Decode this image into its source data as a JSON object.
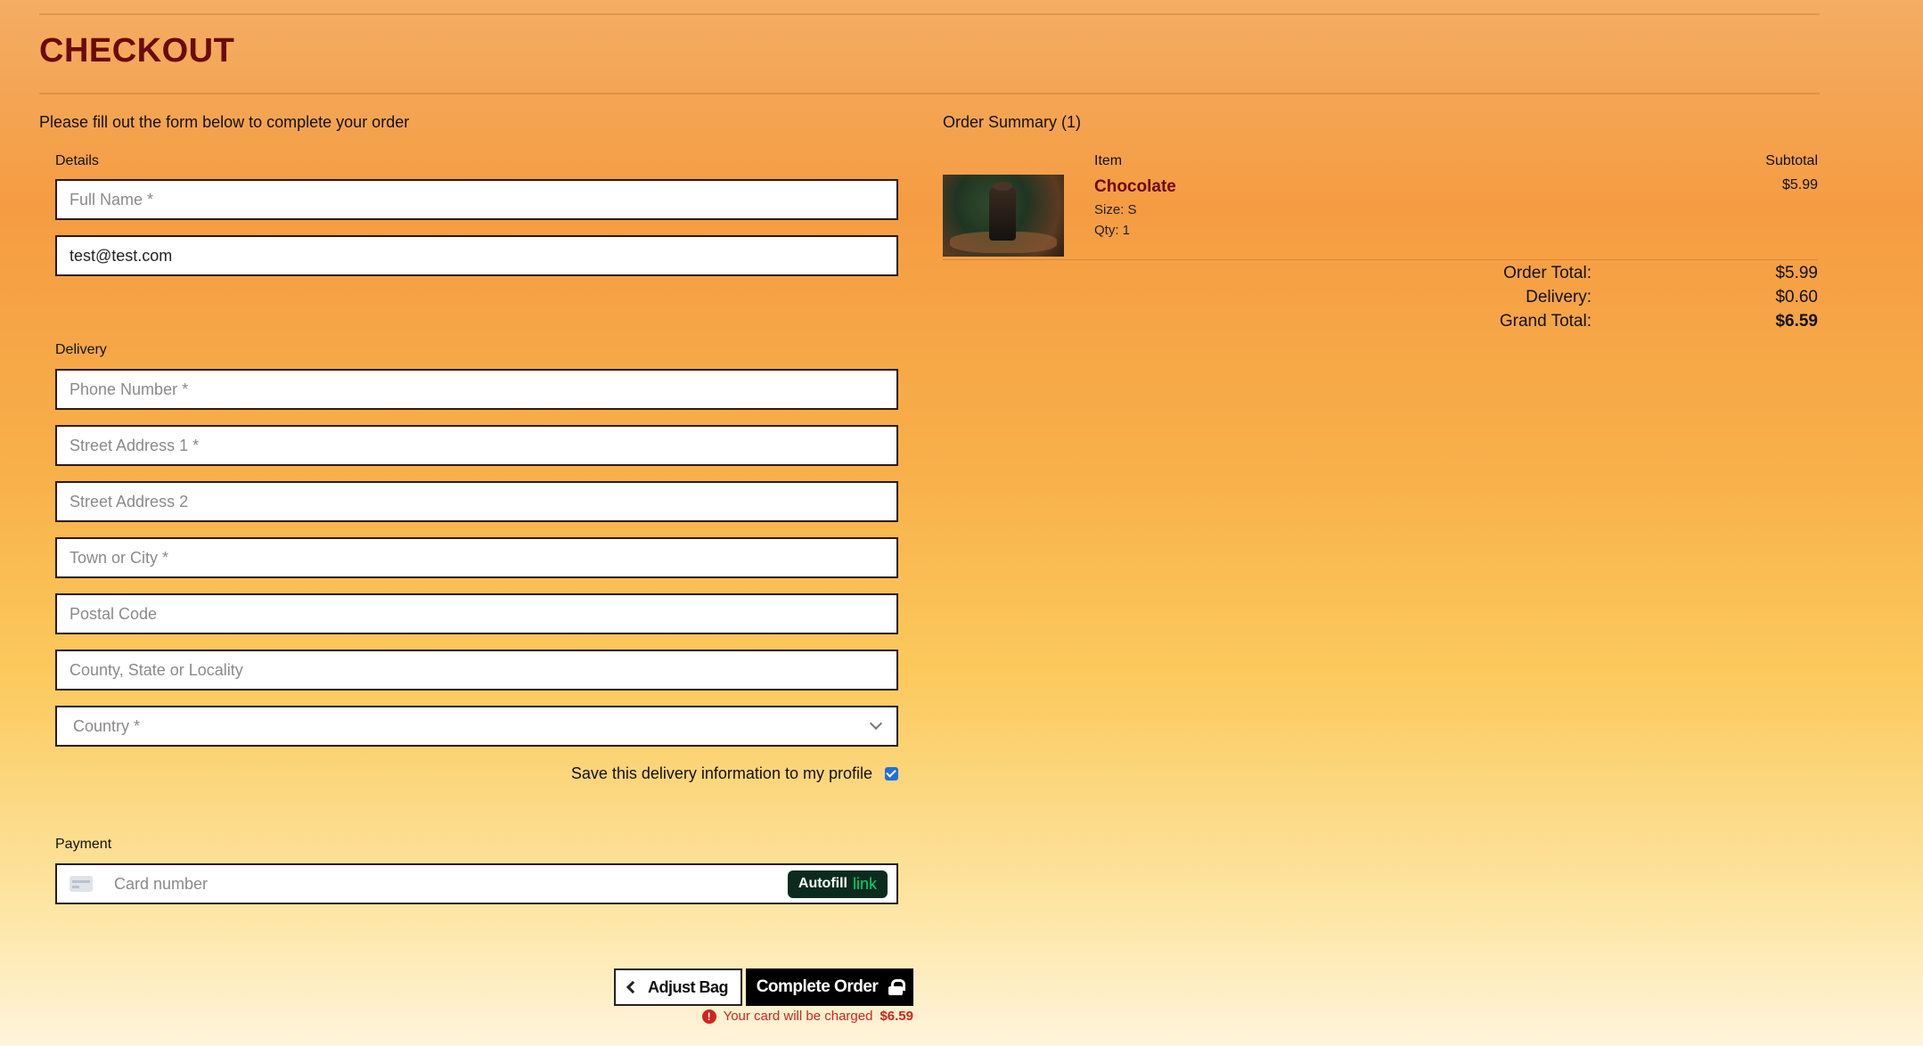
{
  "header": {
    "title": "CHECKOUT"
  },
  "form": {
    "intro": "Please fill out the form below to complete your order",
    "details_label": "Details",
    "full_name_placeholder": "Full Name *",
    "email_value": "test@test.com",
    "delivery_label": "Delivery",
    "phone_placeholder": "Phone Number *",
    "street1_placeholder": "Street Address 1 *",
    "street2_placeholder": "Street Address 2",
    "town_placeholder": "Town or City *",
    "postal_placeholder": "Postal Code",
    "county_placeholder": "County, State or Locality",
    "country_placeholder": "Country *",
    "save_info_label": "Save this delivery information to my profile",
    "save_info_checked": true,
    "payment_label": "Payment",
    "card_placeholder": "Card number",
    "autofill_label": "Autofill",
    "autofill_link": "link"
  },
  "actions": {
    "adjust_bag": "Adjust Bag",
    "complete_order": "Complete Order",
    "charge_text": "Your card will be charged",
    "charge_amount": "$6.59"
  },
  "summary": {
    "title": "Order Summary (1)",
    "item_col": "Item",
    "subtotal_col": "Subtotal",
    "items": [
      {
        "name": "Chocolate",
        "size": "Size: S",
        "qty": "Qty: 1",
        "subtotal": "$5.99"
      }
    ],
    "order_total_label": "Order Total:",
    "order_total": "$5.99",
    "delivery_label": "Delivery:",
    "delivery": "$0.60",
    "grand_total_label": "Grand Total:",
    "grand_total": "$6.59"
  },
  "colors": {
    "title": "#6a0b0b",
    "error": "#d0241e",
    "link_green": "#00d66f"
  }
}
